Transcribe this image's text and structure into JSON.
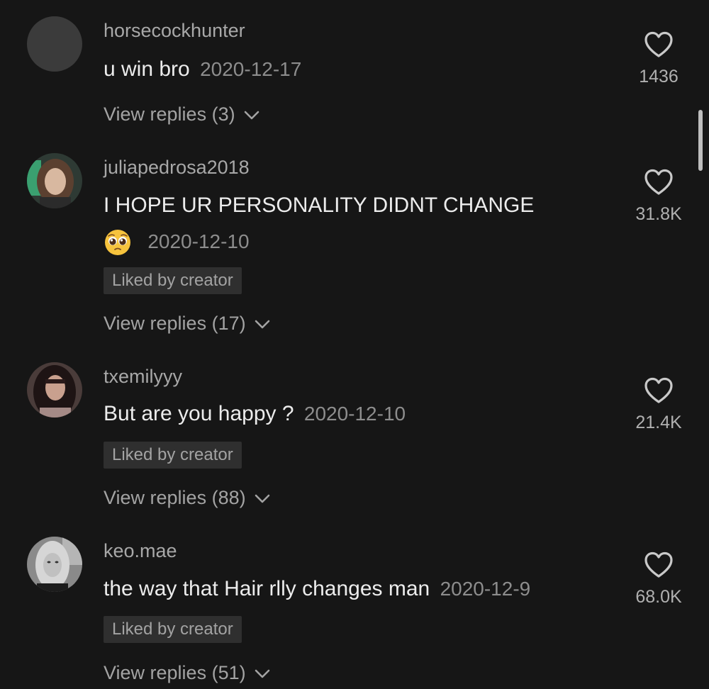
{
  "comments": [
    {
      "username": "horsecockhunter",
      "text": "u win bro",
      "date": "2020-12-17",
      "likes": "1436",
      "liked_by_creator": "",
      "view_replies": "View replies (3)",
      "avatar": "gray-placeholder"
    },
    {
      "username": "juliapedrosa2018",
      "text": "I HOPE UR PERSONALITY DIDNT CHANGE",
      "emoji": "pleading-face-emoji",
      "date": "2020-12-10",
      "likes": "31.8K",
      "liked_by_creator": "Liked by creator",
      "view_replies": "View replies (17)",
      "avatar": "photo"
    },
    {
      "username": "txemilyyy",
      "text": "But are you happy ?",
      "date": "2020-12-10",
      "likes": "21.4K",
      "liked_by_creator": "Liked by creator",
      "view_replies": "View replies (88)",
      "avatar": "photo"
    },
    {
      "username": "keo.mae",
      "text": "the way that Hair rlly changes man",
      "date": "2020-12-9",
      "likes": "68.0K",
      "liked_by_creator": "Liked by creator",
      "view_replies": "View replies (51)",
      "avatar": "photo-grayscale"
    }
  ],
  "colors": {
    "background": "#161616",
    "text": "#ececec",
    "muted": "#8d8d8d",
    "badge_bg": "#2f2f2f"
  }
}
